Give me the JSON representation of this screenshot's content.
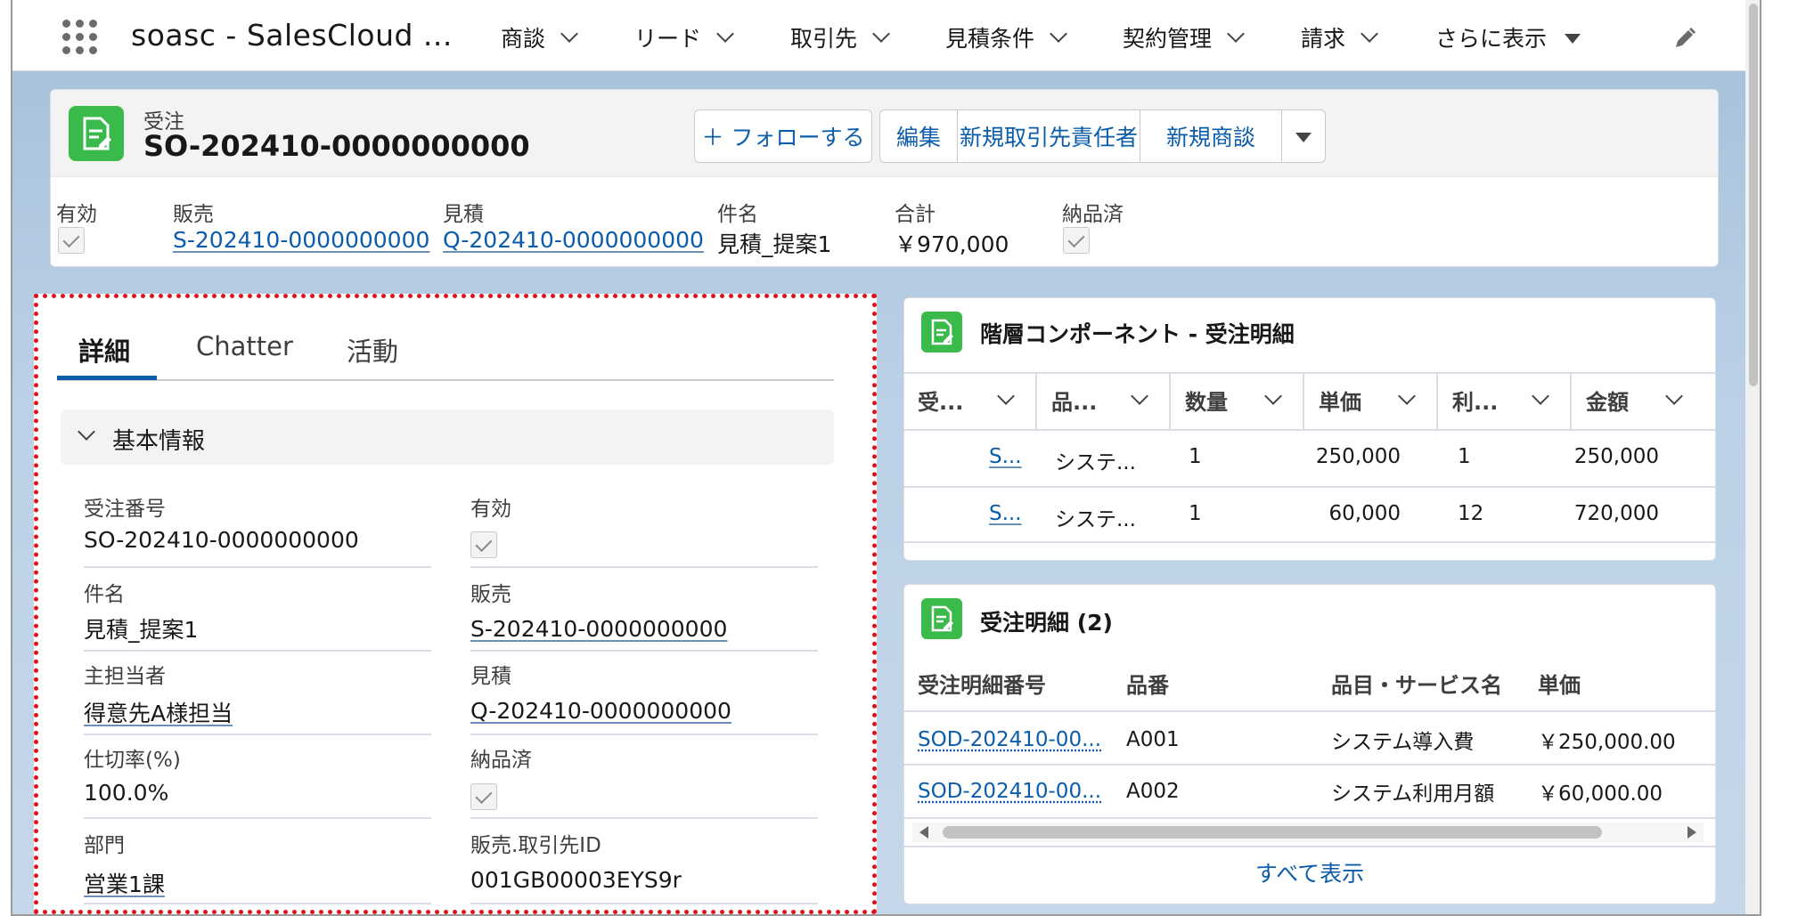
{
  "nav": {
    "app_name": "soasc - SalesCloud ...",
    "items": [
      {
        "label": "商談"
      },
      {
        "label": "リード"
      },
      {
        "label": "取引先"
      },
      {
        "label": "見積条件"
      },
      {
        "label": "契約管理"
      },
      {
        "label": "請求"
      }
    ],
    "more_label": "さらに表示",
    "edit_icon": "pencil-icon"
  },
  "record": {
    "object_label": "受注",
    "title": "SO-202410-0000000000",
    "buttons": {
      "follow": "＋ フォローする",
      "edit": "編集",
      "new_contact": "新規取引先責任者",
      "new_opportunity": "新規商談"
    },
    "highlights": [
      {
        "label": "有効",
        "value": "",
        "type": "checkbox"
      },
      {
        "label": "販売",
        "value": "S-202410-0000000000",
        "type": "link"
      },
      {
        "label": "見積",
        "value": "Q-202410-0000000000",
        "type": "link"
      },
      {
        "label": "件名",
        "value": "見積_提案1",
        "type": "text"
      },
      {
        "label": "合計",
        "value": "￥970,000",
        "type": "text"
      },
      {
        "label": "納品済",
        "value": "",
        "type": "checkbox"
      }
    ]
  },
  "detail": {
    "tabs": [
      "詳細",
      "Chatter",
      "活動"
    ],
    "section_title": "基本情報",
    "fields": [
      {
        "label": "受注番号",
        "value": "SO-202410-0000000000",
        "type": "text"
      },
      {
        "label": "有効",
        "value": "",
        "type": "checkbox"
      },
      {
        "label": "件名",
        "value": "見積_提案1",
        "type": "text"
      },
      {
        "label": "販売",
        "value": "S-202410-0000000000",
        "type": "link"
      },
      {
        "label": "主担当者",
        "value": "得意先A様担当",
        "type": "link"
      },
      {
        "label": "見積",
        "value": "Q-202410-0000000000",
        "type": "link"
      },
      {
        "label": "仕切率(%)",
        "value": "100.0%",
        "type": "text"
      },
      {
        "label": "納品済",
        "value": "",
        "type": "checkbox"
      },
      {
        "label": "部門",
        "value": "営業1課",
        "type": "link"
      },
      {
        "label": "販売.取引先ID",
        "value": "001GB00003EYS9r",
        "type": "text"
      }
    ]
  },
  "hierarchy": {
    "title": "階層コンポーネント - 受注明細",
    "columns": [
      "受...",
      "品...",
      "数量",
      "単価",
      "利...",
      "金額"
    ],
    "rows": [
      [
        "S...",
        "システ...",
        "1",
        "250,000",
        "1",
        "250,000"
      ],
      [
        "S...",
        "システ...",
        "1",
        "60,000",
        "12",
        "720,000"
      ]
    ]
  },
  "lines": {
    "title": "受注明細 (2)",
    "columns": [
      "受注明細番号",
      "品番",
      "品目・サービス名",
      "単価"
    ],
    "rows": [
      [
        "SOD-202410-00...",
        "A001",
        "システム導入費",
        "￥250,000.00"
      ],
      [
        "SOD-202410-00...",
        "A002",
        "システム利用月額",
        "￥60,000.00"
      ]
    ],
    "view_all": "すべて表示"
  }
}
